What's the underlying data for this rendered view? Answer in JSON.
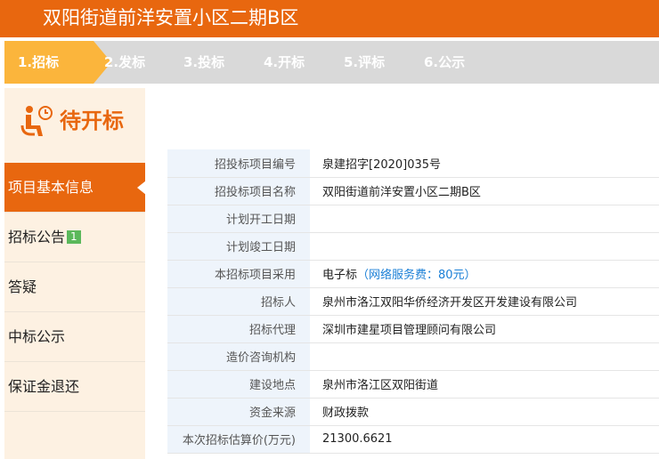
{
  "header": {
    "title": "双阳街道前洋安置小区二期B区"
  },
  "steps": [
    {
      "label": "1.招标",
      "active": true
    },
    {
      "label": "2.发标"
    },
    {
      "label": "3.投标"
    },
    {
      "label": "4.开标"
    },
    {
      "label": "5.评标"
    },
    {
      "label": "6.公示"
    }
  ],
  "status": {
    "text": "待开标",
    "icon": "person-waiting-clock-icon"
  },
  "menu": [
    {
      "label": "项目基本信息",
      "active": true
    },
    {
      "label": "招标公告",
      "badge": "1"
    },
    {
      "label": "答疑"
    },
    {
      "label": "中标公示"
    },
    {
      "label": "保证金退还"
    }
  ],
  "details": [
    {
      "label": "招投标项目编号",
      "value": "泉建招字[2020]035号"
    },
    {
      "label": "招投标项目名称",
      "value": "双阳街道前洋安置小区二期B区"
    },
    {
      "label": "计划开工日期",
      "value": ""
    },
    {
      "label": "计划竣工日期",
      "value": ""
    },
    {
      "label": "本招标项目采用",
      "value": "电子标",
      "fee": "（网络服务费：80元）"
    },
    {
      "label": "招标人",
      "value": "泉州市洛江双阳华侨经济开发区开发建设有限公司"
    },
    {
      "label": "招标代理",
      "value": "深圳市建星项目管理顾问有限公司"
    },
    {
      "label": "造价咨询机构",
      "value": ""
    },
    {
      "label": "建设地点",
      "value": "泉州市洛江区双阳街道"
    },
    {
      "label": "资金来源",
      "value": "财政拨款"
    },
    {
      "label": "本次招标估算价(万元)",
      "value": "21300.6621"
    }
  ],
  "colors": {
    "accent": "#e8670f",
    "step_active": "#fbb53c",
    "badge": "#5bb85b",
    "fee_link": "#1a7fd6"
  }
}
